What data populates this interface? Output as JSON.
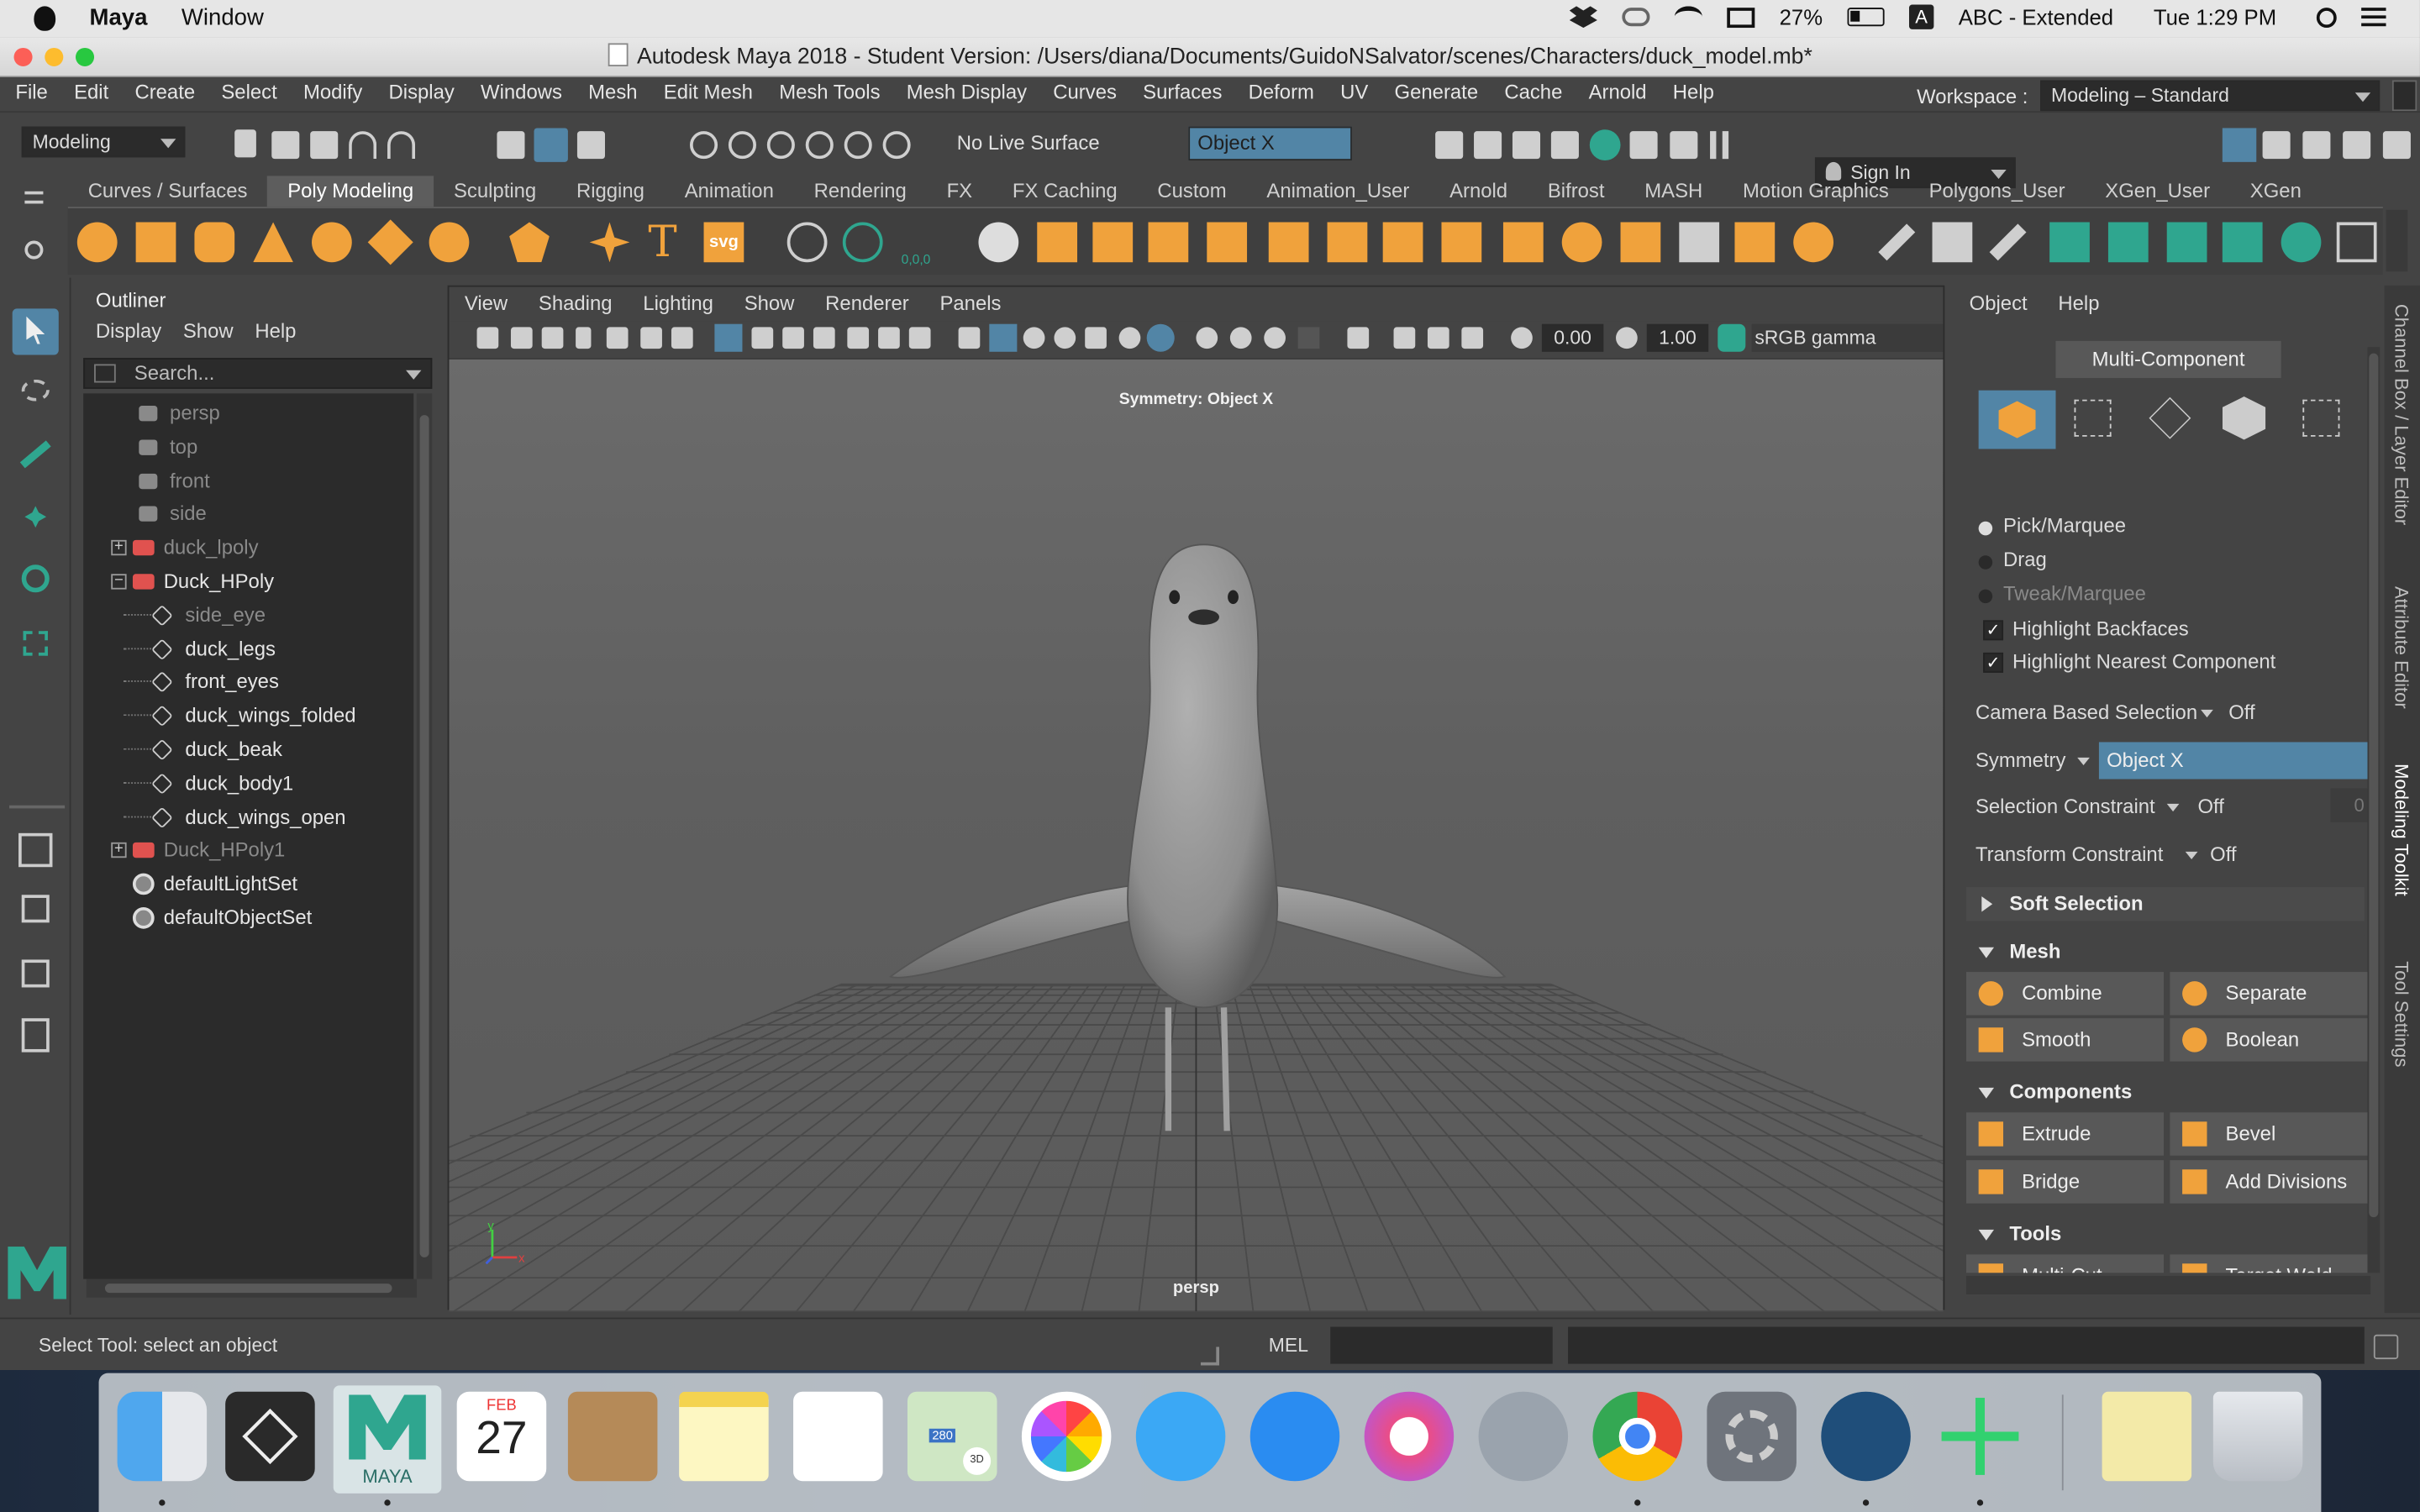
{
  "macbar": {
    "app_name": "Maya",
    "menu": "Window",
    "battery": "27%",
    "input_source": "ABC - Extended",
    "clock": "Tue 1:29 PM"
  },
  "window": {
    "title": "Autodesk Maya 2018 - Student Version: /Users/diana/Documents/GuidoNSalvator/scenes/Characters/duck_model.mb*"
  },
  "main_menu": [
    "File",
    "Edit",
    "Create",
    "Select",
    "Modify",
    "Display",
    "Windows",
    "Mesh",
    "Edit Mesh",
    "Mesh Tools",
    "Mesh Display",
    "Curves",
    "Surfaces",
    "Deform",
    "UV",
    "Generate",
    "Cache",
    "Arnold",
    "Help"
  ],
  "workspace": {
    "label": "Workspace :",
    "value": "Modeling – Standard"
  },
  "statusline": {
    "menu_set": "Modeling",
    "live_surface": "No Live Surface",
    "symmetry_field": "Object X",
    "sign_in": "Sign In"
  },
  "shelf_tabs": [
    "Curves / Surfaces",
    "Poly Modeling",
    "Sculpting",
    "Rigging",
    "Animation",
    "Rendering",
    "FX",
    "FX Caching",
    "Custom",
    "Animation_User",
    "Arnold",
    "Bifrost",
    "MASH",
    "Motion Graphics",
    "Polygons_User",
    "XGen_User",
    "XGen"
  ],
  "shelf_active": "Poly Modeling",
  "shelf_text_icons": {
    "svg": "svg",
    "coords": "0,0,0"
  },
  "outliner": {
    "title": "Outliner",
    "menus": [
      "Display",
      "Show",
      "Help"
    ],
    "search_placeholder": "Search...",
    "items": [
      {
        "label": "persp",
        "indent": 1,
        "dim": true,
        "type": "camera"
      },
      {
        "label": "top",
        "indent": 1,
        "dim": true,
        "type": "camera"
      },
      {
        "label": "front",
        "indent": 1,
        "dim": true,
        "type": "camera"
      },
      {
        "label": "side",
        "indent": 1,
        "dim": true,
        "type": "camera"
      },
      {
        "label": "duck_lpoly",
        "indent": 0,
        "dim": true,
        "type": "group",
        "expander": "+"
      },
      {
        "label": "Duck_HPoly",
        "indent": 0,
        "dim": false,
        "type": "group",
        "expander": "−"
      },
      {
        "label": "side_eye",
        "indent": 2,
        "dim": true,
        "type": "mesh"
      },
      {
        "label": "duck_legs",
        "indent": 2,
        "dim": false,
        "type": "mesh"
      },
      {
        "label": "front_eyes",
        "indent": 2,
        "dim": false,
        "type": "mesh"
      },
      {
        "label": "duck_wings_folded",
        "indent": 2,
        "dim": false,
        "type": "mesh"
      },
      {
        "label": "duck_beak",
        "indent": 2,
        "dim": false,
        "type": "mesh"
      },
      {
        "label": "duck_body1",
        "indent": 2,
        "dim": false,
        "type": "mesh"
      },
      {
        "label": "duck_wings_open",
        "indent": 2,
        "dim": false,
        "type": "mesh"
      },
      {
        "label": "Duck_HPoly1",
        "indent": 0,
        "dim": true,
        "type": "group",
        "expander": "+"
      },
      {
        "label": "defaultLightSet",
        "indent": 1,
        "dim": false,
        "type": "set"
      },
      {
        "label": "defaultObjectSet",
        "indent": 1,
        "dim": false,
        "type": "set"
      }
    ]
  },
  "viewport": {
    "menus": [
      "View",
      "Shading",
      "Lighting",
      "Show",
      "Renderer",
      "Panels"
    ],
    "exposure": "0.00",
    "gamma": "1.00",
    "color_space": "sRGB gamma",
    "symmetry_label": "Symmetry: Object X",
    "camera": "persp",
    "axis_x": "x",
    "axis_y": "y"
  },
  "modeling_toolkit": {
    "menus": [
      "Object",
      "Help"
    ],
    "mode_button": "Multi-Component",
    "pick_modes": [
      {
        "label": "Pick/Marquee",
        "on": true,
        "dim": false
      },
      {
        "label": "Drag",
        "on": false,
        "dim": false
      },
      {
        "label": "Tweak/Marquee",
        "on": false,
        "dim": true
      }
    ],
    "checks": [
      "Highlight Backfaces",
      "Highlight Nearest Component"
    ],
    "camera_based_selection": {
      "label": "Camera Based Selection",
      "value": "Off"
    },
    "symmetry": {
      "label": "Symmetry",
      "value": "Object X"
    },
    "selection_constraint": {
      "label": "Selection Constraint",
      "value": "Off",
      "count": "0"
    },
    "transform_constraint": {
      "label": "Transform Constraint",
      "value": "Off"
    },
    "soft_selection": "Soft Selection",
    "mesh": {
      "header": "Mesh",
      "buttons": [
        "Combine",
        "Separate",
        "Smooth",
        "Boolean"
      ]
    },
    "components": {
      "header": "Components",
      "buttons": [
        "Extrude",
        "Bevel",
        "Bridge",
        "Add Divisions"
      ]
    },
    "tools": {
      "header": "Tools",
      "buttons": [
        "Multi-Cut",
        "Target Weld"
      ]
    }
  },
  "side_tabs": [
    "Channel Box / Layer Editor",
    "Attribute Editor",
    "Modeling Toolkit",
    "Tool Settings"
  ],
  "helpline": {
    "text": "Select Tool: select an object",
    "script_lang": "MEL"
  },
  "dock": {
    "calendar_month": "FEB",
    "calendar_day": "27",
    "maya_label": "MAYA",
    "maps_badge": "280",
    "maps_3d": "3D"
  },
  "colors": {
    "accent_orange": "#f0a23c",
    "selection_blue": "#5285a6",
    "panel_bg": "#444444"
  }
}
